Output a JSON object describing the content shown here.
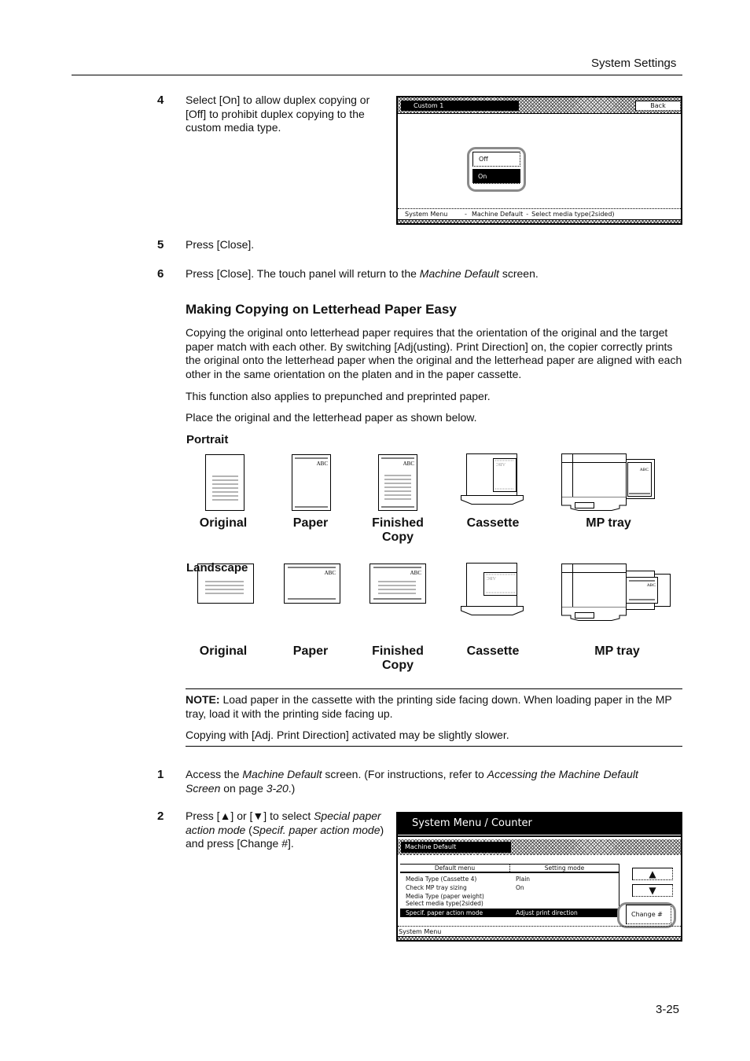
{
  "header": {
    "title": "System Settings"
  },
  "steps_top": [
    {
      "num": "4",
      "text": "Select [On] to allow duplex copying or [Off] to prohibit duplex copying to the custom media type."
    },
    {
      "num": "5",
      "text": "Press [Close]."
    },
    {
      "num": "6",
      "text_before": "Press [Close]. The touch panel will return to the ",
      "text_italic": "Machine Default",
      "text_after": " screen."
    }
  ],
  "panel1": {
    "tab_label": "Custom 1",
    "back_button": "Back",
    "options": [
      {
        "label": "Off",
        "selected": false
      },
      {
        "label": "On",
        "selected": true
      }
    ],
    "status": {
      "part1": "System Menu",
      "sep1": "-",
      "part2": "Machine Default",
      "sep2": "-",
      "part3": "Select media type(2sided)"
    }
  },
  "section": {
    "title": "Making Copying on Letterhead Paper Easy",
    "paragraphs": [
      "Copying the original onto letterhead paper requires that the orientation of the original and the target paper match with each other. By switching [Adj(usting). Print Direction] on, the copier correctly prints the original onto the letterhead paper when the original and the letterhead paper are aligned with each other in the same orientation on the platen and in the paper cassette.",
      "This function also applies to prepunched and preprinted paper.",
      "Place the original and the letterhead paper as shown below."
    ]
  },
  "figures": {
    "portrait": {
      "heading": "Portrait",
      "labels": [
        "Original",
        "Paper",
        "Finished Copy",
        "Cassette",
        "MP tray"
      ]
    },
    "landscape": {
      "heading": "Landscape",
      "labels": [
        "Original",
        "Paper",
        "Finished Copy",
        "Cassette",
        "MP tray"
      ]
    },
    "letterhead_text": "ABC"
  },
  "note": {
    "label": "NOTE:",
    "text": " Load paper in the cassette with the printing side facing down. When loading paper in the MP tray, load it with the printing side facing up.",
    "text2": "Copying with [Adj. Print Direction] activated may be slightly slower."
  },
  "steps_bottom": [
    {
      "num": "1",
      "t1": "Access the ",
      "i1": "Machine Default",
      "t2": " screen. (For instructions, refer to ",
      "i2": "Accessing the Machine Default Screen",
      "t3": " on page ",
      "i3": "3-20",
      "t4": ".)"
    },
    {
      "num": "2",
      "t1": "Press [▲] or [▼] to select ",
      "i1": "Special paper action mode",
      "t2": " (",
      "i2": "Specif. paper action mode",
      "t3": ") and press [Change #]."
    }
  ],
  "panel2": {
    "title": "System Menu / Counter",
    "tab_label": "Machine Default",
    "columns": [
      "Default menu",
      "Setting mode"
    ],
    "rows": [
      {
        "menu": "Media Type (Cassette 4)",
        "setting": "Plain",
        "selected": false
      },
      {
        "menu": "Check MP tray sizing",
        "setting": "On",
        "selected": false
      },
      {
        "menu": "Media Type (paper weight)",
        "setting": "",
        "selected": false
      },
      {
        "menu": "Select media type(2sided)",
        "setting": "",
        "selected": false
      },
      {
        "menu": "Specif. paper action mode",
        "setting": "Adjust print direction",
        "selected": true
      }
    ],
    "up_button": "▲",
    "down_button": "▼",
    "change_button": "Change #",
    "status": "System Menu"
  },
  "page_number": "3-25"
}
